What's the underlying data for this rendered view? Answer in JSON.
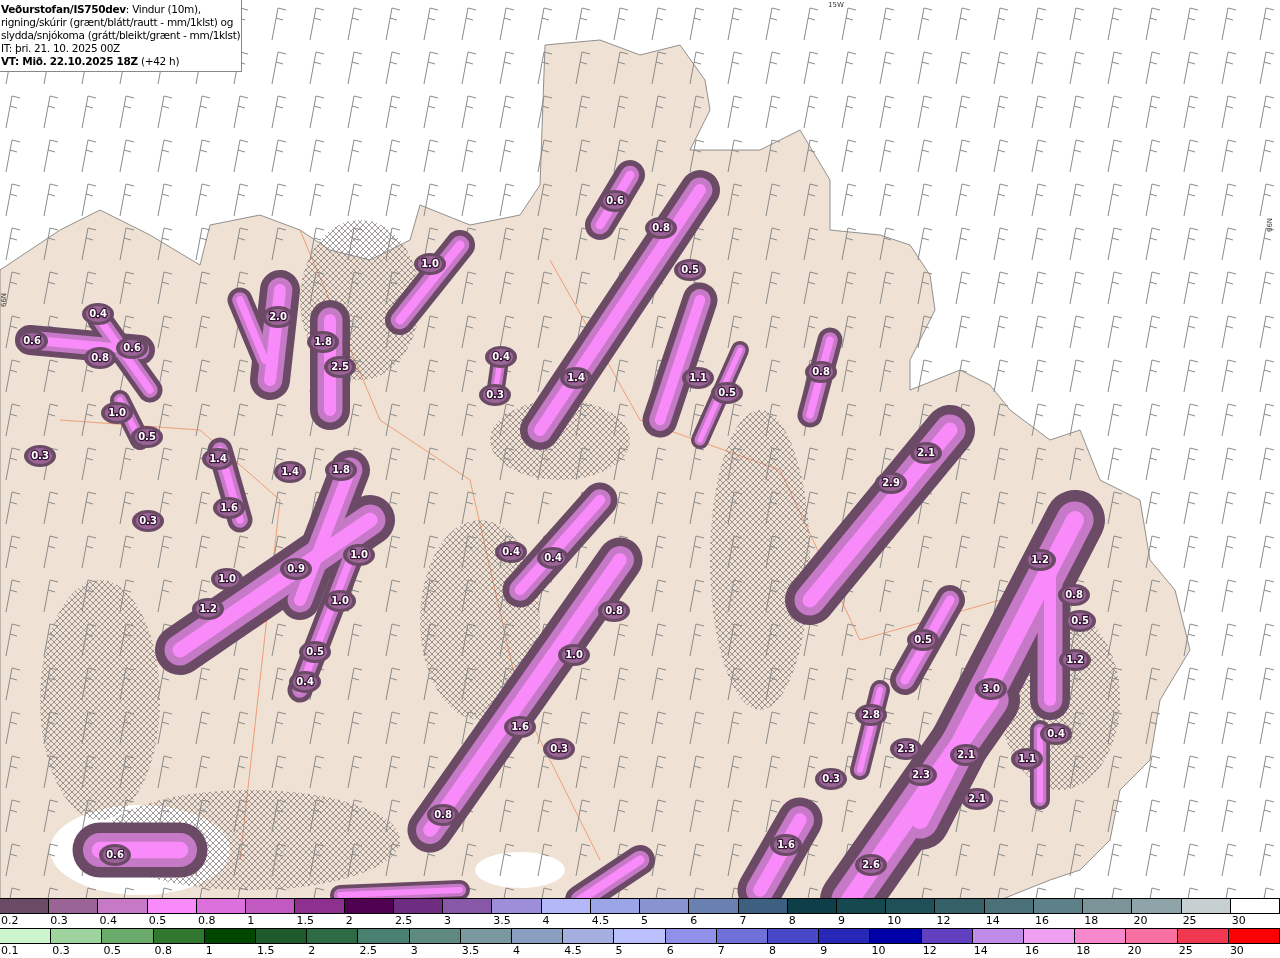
{
  "header": {
    "title": "**Veðurstofan/IS750dev**: Vindur (10m), rigning/skúrir (grænt/blátt/rautt - mm/1klst) og slydda/snjókoma (grátt/bleikt/grænt - mm/1klst)",
    "initial_time": "IT: þri. 21. 10. 2025 00Z",
    "valid_time": "**VT: Mið. 22.10.2025 18Z** (+42 h)"
  },
  "grid_labels": [
    "15W",
    "66N",
    "66N"
  ],
  "map_labels": [
    "0.6",
    "0.8",
    "1.0",
    "0.5",
    "0.4",
    "2.0",
    "0.6",
    "1.8",
    "0.6",
    "0.8",
    "0.4",
    "2.5",
    "1.4",
    "1.1",
    "0.8",
    "0.3",
    "0.5",
    "1.0",
    "0.5",
    "0.3",
    "1.4",
    "2.1",
    "1.4",
    "1.8",
    "2.9",
    "1.6",
    "0.3",
    "1.0",
    "0.4",
    "0.4",
    "1.2",
    "0.9",
    "1.0",
    "0.8",
    "1.0",
    "1.2",
    "0.8",
    "0.5",
    "0.5",
    "0.5",
    "1.0",
    "1.2",
    "0.4",
    "3.0",
    "2.8",
    "1.6",
    "0.4",
    "2.3",
    "0.3",
    "2.1",
    "1.1",
    "2.3",
    "0.3",
    "2.1",
    "0.8",
    "1.6",
    "0.6",
    "2.6"
  ],
  "snow_legend": [
    {
      "label": "0.2",
      "color": "#6b4a66"
    },
    {
      "label": "0.3",
      "color": "#9a6497"
    },
    {
      "label": "0.4",
      "color": "#c679c6"
    },
    {
      "label": "0.5",
      "color": "#f98af9"
    },
    {
      "label": "0.8",
      "color": "#dc70dc"
    },
    {
      "label": "1",
      "color": "#c05ac0"
    },
    {
      "label": "1.5",
      "color": "#8e3090"
    },
    {
      "label": "2",
      "color": "#4f0050"
    },
    {
      "label": "2.5",
      "color": "#6e2d80"
    },
    {
      "label": "3",
      "color": "#8858a8"
    },
    {
      "label": "3.5",
      "color": "#9c8ed8"
    },
    {
      "label": "4",
      "color": "#b4b8f8"
    },
    {
      "label": "4.5",
      "color": "#9aa6e6"
    },
    {
      "label": "5",
      "color": "#8894d0"
    },
    {
      "label": "6",
      "color": "#6a80b0"
    },
    {
      "label": "7",
      "color": "#3e6080"
    },
    {
      "label": "8",
      "color": "#0e3f48"
    },
    {
      "label": "9",
      "color": "#164850"
    },
    {
      "label": "10",
      "color": "#1f5058"
    },
    {
      "label": "12",
      "color": "#356068"
    },
    {
      "label": "14",
      "color": "#4a7078"
    },
    {
      "label": "16",
      "color": "#5e8088"
    },
    {
      "label": "18",
      "color": "#7a9498"
    },
    {
      "label": "20",
      "color": "#8fa4a8"
    },
    {
      "label": "25",
      "color": "#c6d0d0"
    },
    {
      "label": "30",
      "color": "#ffffff"
    }
  ],
  "rain_legend": [
    {
      "label": "0.1",
      "color": "#ccf5cc"
    },
    {
      "label": "0.3",
      "color": "#9ed49e"
    },
    {
      "label": "0.5",
      "color": "#6aaa6a"
    },
    {
      "label": "0.8",
      "color": "#307830"
    },
    {
      "label": "1",
      "color": "#004800"
    },
    {
      "label": "1.5",
      "color": "#1f5a2c"
    },
    {
      "label": "2",
      "color": "#2e6a44"
    },
    {
      "label": "2.5",
      "color": "#4a8070"
    },
    {
      "label": "3",
      "color": "#608a80"
    },
    {
      "label": "3.5",
      "color": "#7a98a0"
    },
    {
      "label": "4",
      "color": "#8a9ec0"
    },
    {
      "label": "4.5",
      "color": "#a6b0e0"
    },
    {
      "label": "5",
      "color": "#bcc0ff"
    },
    {
      "label": "6",
      "color": "#9090e8"
    },
    {
      "label": "7",
      "color": "#7070d8"
    },
    {
      "label": "8",
      "color": "#4848c8"
    },
    {
      "label": "9",
      "color": "#2828b8"
    },
    {
      "label": "10",
      "color": "#0000a8"
    },
    {
      "label": "12",
      "color": "#6040c0"
    },
    {
      "label": "14",
      "color": "#c08ce8"
    },
    {
      "label": "16",
      "color": "#f0a0f0"
    },
    {
      "label": "18",
      "color": "#f888cc"
    },
    {
      "label": "20",
      "color": "#f870a0"
    },
    {
      "label": "25",
      "color": "#f03850"
    },
    {
      "label": "30",
      "color": "#ff0000"
    }
  ]
}
